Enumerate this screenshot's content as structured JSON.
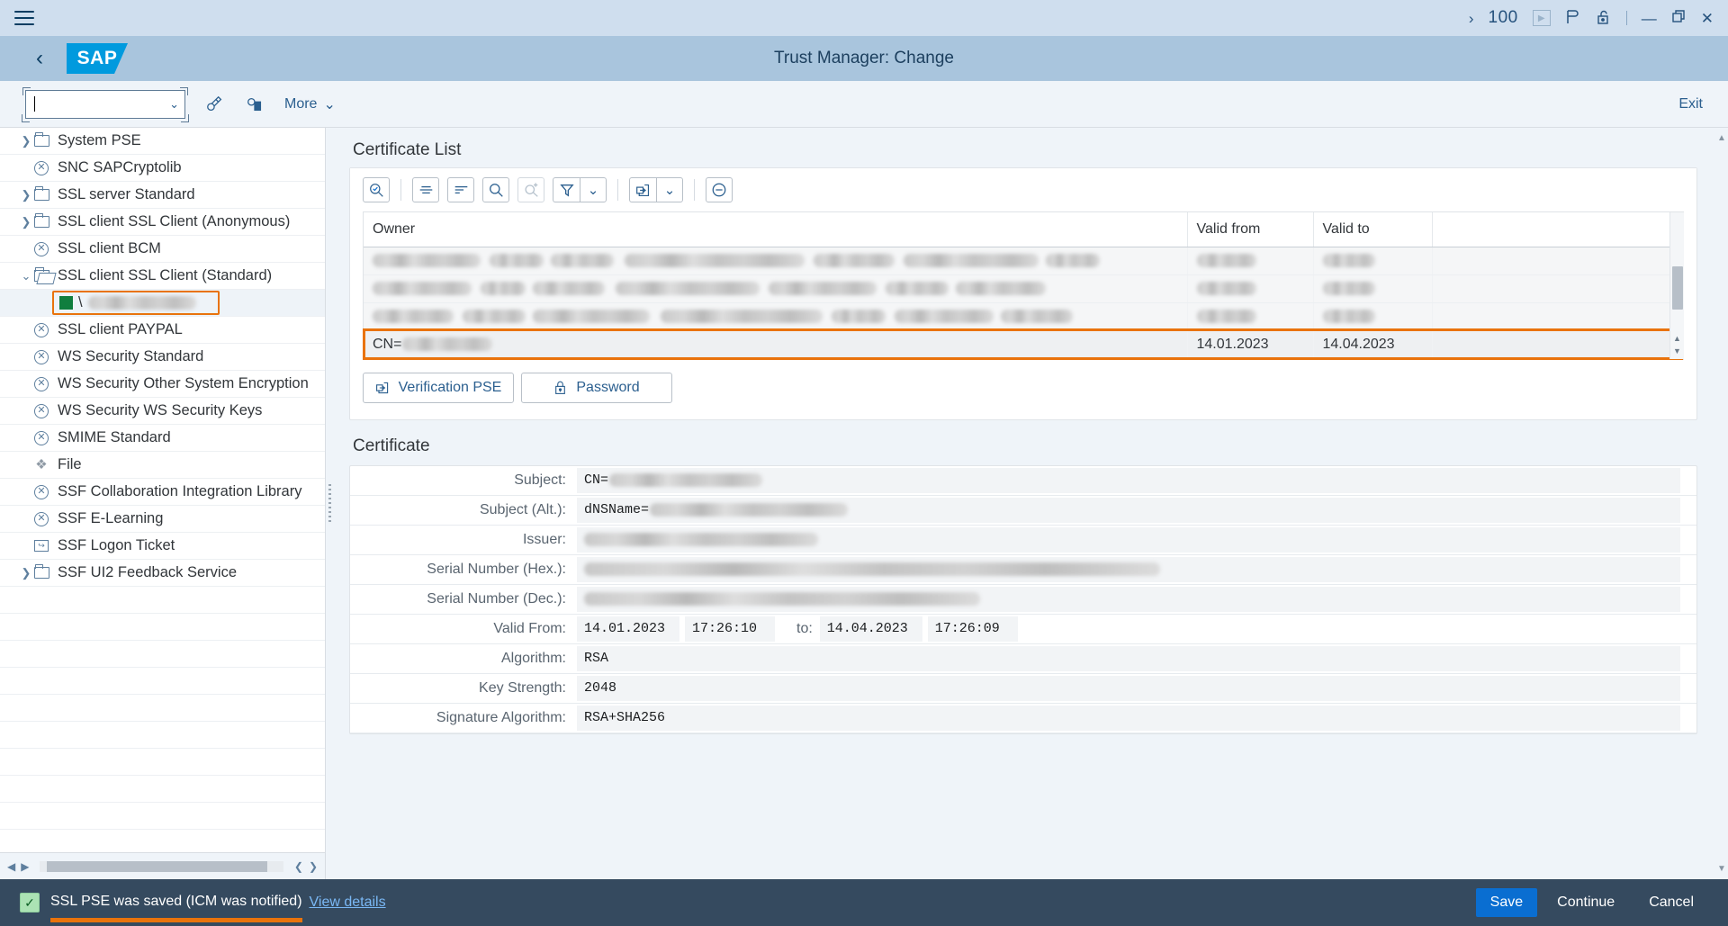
{
  "shell": {
    "menu_icon": "hamburger-icon",
    "overflow_glyph": "›",
    "session_number": "100",
    "icons": [
      "play-icon",
      "sap-p-icon",
      "unlock-icon"
    ],
    "window_controls": [
      "minimize",
      "restore",
      "close"
    ]
  },
  "header": {
    "back_label": "‹",
    "logo_text": "SAP",
    "title": "Trust Manager: Change"
  },
  "toolbar": {
    "search_value": "",
    "search_placeholder": "",
    "dropdown_caret": "⌄",
    "icon_edit": "pen-edit-icon",
    "icon_lock": "lock-display-icon",
    "more_label": "More",
    "exit_label": "Exit"
  },
  "tree": {
    "items": [
      {
        "label": "System PSE",
        "icon": "folder-icon",
        "twisty": "collapsed",
        "indent": 0
      },
      {
        "label": "SNC SAPCryptolib",
        "icon": "circle-x-icon",
        "twisty": "none",
        "indent": 0
      },
      {
        "label": "SSL server Standard",
        "icon": "folder-icon",
        "twisty": "collapsed",
        "indent": 0
      },
      {
        "label": "SSL client SSL Client (Anonymous)",
        "icon": "folder-icon",
        "twisty": "collapsed",
        "indent": 0
      },
      {
        "label": "SSL client BCM",
        "icon": "circle-x-icon",
        "twisty": "none",
        "indent": 0
      },
      {
        "label": "SSL client SSL Client (Standard)",
        "icon": "folder-open-icon",
        "twisty": "expanded",
        "indent": 0
      },
      {
        "label": "\\",
        "icon": "green-square-icon",
        "twisty": "none",
        "indent": 1,
        "selected": true,
        "redacted": true
      },
      {
        "label": "SSL client PAYPAL",
        "icon": "circle-x-icon",
        "twisty": "none",
        "indent": 0
      },
      {
        "label": "WS Security Standard",
        "icon": "circle-x-icon",
        "twisty": "none",
        "indent": 0
      },
      {
        "label": "WS Security Other System Encryption",
        "icon": "circle-x-icon",
        "twisty": "none",
        "indent": 0
      },
      {
        "label": "WS Security WS Security Keys",
        "icon": "circle-x-icon",
        "twisty": "none",
        "indent": 0
      },
      {
        "label": "SMIME Standard",
        "icon": "circle-x-icon",
        "twisty": "none",
        "indent": 0
      },
      {
        "label": "File",
        "icon": "file-gear-icon",
        "twisty": "none",
        "indent": 0
      },
      {
        "label": "SSF Collaboration Integration Library",
        "icon": "circle-x-icon",
        "twisty": "none",
        "indent": 0
      },
      {
        "label": "SSF E-Learning",
        "icon": "circle-x-icon",
        "twisty": "none",
        "indent": 0
      },
      {
        "label": "SSF Logon Ticket",
        "icon": "ticket-icon",
        "twisty": "none",
        "indent": 0
      },
      {
        "label": "SSF UI2 Feedback Service",
        "icon": "folder-icon",
        "twisty": "collapsed",
        "indent": 0
      }
    ]
  },
  "certificate_list": {
    "title": "Certificate List",
    "toolbar_icons": [
      "search-detail-icon",
      "sort-center-icon",
      "sort-filter-icon",
      "search-icon",
      "search-add-icon",
      "filter-icon",
      "filter-dropdown-caret",
      "import-icon",
      "import-dropdown-caret",
      "remove-icon"
    ],
    "columns": [
      "Owner",
      "Valid from",
      "Valid to",
      ""
    ],
    "rows": [
      {
        "owner": "",
        "valid_from": "",
        "valid_to": "",
        "redacted": true
      },
      {
        "owner": "",
        "valid_from": "",
        "valid_to": "",
        "redacted": true
      },
      {
        "owner": "",
        "valid_from": "",
        "valid_to": "",
        "redacted": true
      },
      {
        "owner": "CN=",
        "valid_from": "14.01.2023",
        "valid_to": "14.04.2023",
        "redacted": true,
        "highlighted": true
      }
    ],
    "buttons": [
      {
        "label": "Verification PSE",
        "icon": "import-icon"
      },
      {
        "label": "Password",
        "icon": "lock-icon"
      }
    ]
  },
  "certificate": {
    "title": "Certificate",
    "fields": [
      {
        "label": "Subject:",
        "value": "CN=",
        "redacted": true
      },
      {
        "label": "Subject (Alt.):",
        "value": "dNSName=",
        "redacted": true
      },
      {
        "label": "Issuer:",
        "value": "",
        "redacted": true
      },
      {
        "label": "Serial Number (Hex.):",
        "value": "",
        "redacted": true
      },
      {
        "label": "Serial Number (Dec.):",
        "value": "",
        "redacted": true
      }
    ],
    "valid_from_label": "Valid From:",
    "valid_from_date": "14.01.2023",
    "valid_from_time": "17:26:10",
    "to_label": "to:",
    "valid_to_date": "14.04.2023",
    "valid_to_time": "17:26:09",
    "algorithm_label": "Algorithm:",
    "algorithm_value": "RSA",
    "key_strength_label": "Key Strength:",
    "key_strength_value": "2048",
    "signature_label": "Signature Algorithm:",
    "signature_value": "RSA+SHA256"
  },
  "footer": {
    "status_icon": "checkbox-success-icon",
    "message": "SSL PSE was saved (ICM was notified)",
    "details_link": "View details",
    "buttons": {
      "save": "Save",
      "continue": "Continue",
      "cancel": "Cancel"
    }
  },
  "colors": {
    "accent_orange": "#e9730c",
    "primary_blue": "#0a6ed1",
    "success_green": "#107e3e",
    "footer_bg": "#354a5f"
  }
}
